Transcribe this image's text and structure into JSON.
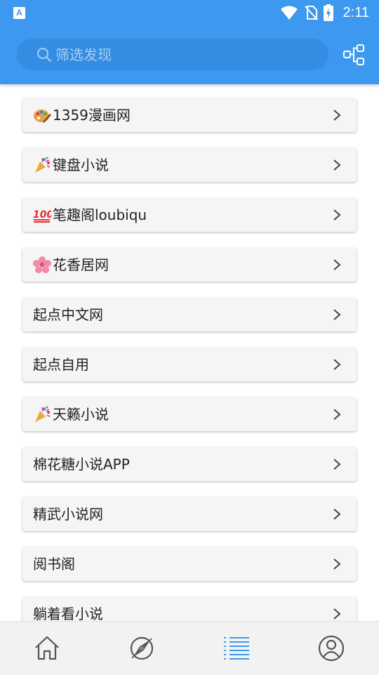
{
  "status_bar": {
    "time": "2:11",
    "app_icon_letter": "A"
  },
  "search": {
    "placeholder": "筛选发现"
  },
  "sources": [
    {
      "label": "1359漫画网",
      "emoji": "palette-icon"
    },
    {
      "label": "键盘小说",
      "emoji": "party-popper-icon"
    },
    {
      "label": "笔趣阁loubiqu",
      "emoji": "hundred-points-icon"
    },
    {
      "label": "花香居网",
      "emoji": "cherry-blossom-icon"
    },
    {
      "label": "起点中文网"
    },
    {
      "label": "起点自用"
    },
    {
      "label": "天籁小说",
      "emoji": "party-popper-icon"
    },
    {
      "label": "棉花糖小说APP"
    },
    {
      "label": "精武小说网"
    },
    {
      "label": "阅书阁"
    },
    {
      "label": "躺着看小说"
    }
  ],
  "bottom_nav": [
    {
      "name": "home",
      "icon": "home-icon",
      "active": false
    },
    {
      "name": "discover",
      "icon": "compass-icon",
      "active": false
    },
    {
      "name": "list",
      "icon": "list-icon",
      "active": true
    },
    {
      "name": "profile",
      "icon": "user-icon",
      "active": false
    }
  ],
  "colors": {
    "primary": "#3d99ef",
    "active_tab": "#3d99ef",
    "inactive_tab": "#555555"
  }
}
